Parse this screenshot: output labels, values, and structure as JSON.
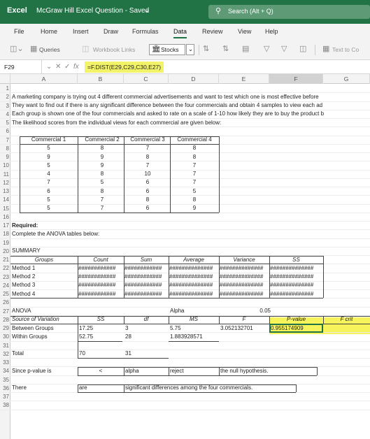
{
  "app": {
    "name": "Excel",
    "doc_title": "McGraw Hill Excel Question  -  Saved",
    "search_placeholder": "Search (Alt + Q)"
  },
  "menu": [
    "File",
    "Home",
    "Insert",
    "Draw",
    "Formulas",
    "Data",
    "Review",
    "View",
    "Help"
  ],
  "ribbon": {
    "queries": "Queries",
    "workbook_links": "Workbook Links",
    "stocks": "Stocks",
    "text_to_cols": "Text to Co"
  },
  "formula_bar": {
    "name_box": "F29",
    "fx": "fx",
    "formula": "=F.DIST(E29,C29,C30,E27)"
  },
  "columns": [
    "A",
    "B",
    "C",
    "D",
    "E",
    "F",
    "G"
  ],
  "rows": [
    "1",
    "2",
    "3",
    "4",
    "5",
    "6",
    "7",
    "8",
    "9",
    "10",
    "11",
    "12",
    "13",
    "14",
    "15",
    "16",
    "17",
    "18",
    "19",
    "20",
    "21",
    "22",
    "23",
    "24",
    "25",
    "26",
    "27",
    "28",
    "29",
    "30",
    "31",
    "32",
    "33",
    "34",
    "35",
    "36",
    "37",
    "38"
  ],
  "intro": {
    "l2": "A marketing company is trying out 4 different commercial advertisements and want to test which one is most effective before",
    "l3": "They want to find out if there is any significant difference between the four commercials and obtain 4 samples to view each ad",
    "l4": "Each group is shown one of the four commercials and asked to rate on a scale of 1-10 how likely they are to buy the product b",
    "l5": "The likelihood scores from the individual views for each commercial are given below:"
  },
  "data_table": {
    "headers": [
      "Commercial 1",
      "Commercial 2",
      "Commercial 3",
      "Commercial 4"
    ],
    "rows": [
      [
        "5",
        "8",
        "7",
        "8"
      ],
      [
        "9",
        "9",
        "8",
        "8"
      ],
      [
        "5",
        "9",
        "7",
        "7"
      ],
      [
        "4",
        "8",
        "10",
        "7"
      ],
      [
        "7",
        "5",
        "6",
        "7"
      ],
      [
        "6",
        "8",
        "6",
        "5"
      ],
      [
        "5",
        "7",
        "8",
        "8"
      ],
      [
        "5",
        "7",
        "6",
        "9"
      ]
    ]
  },
  "required": {
    "label": "Required:",
    "text": "Complete the ANOVA tables below:"
  },
  "summary": {
    "title": "SUMMARY",
    "headers": [
      "Groups",
      "Count",
      "Sum",
      "Average",
      "Variance",
      "SS"
    ],
    "rows": [
      [
        "Method 1",
        "############",
        "############",
        "##############",
        "##############",
        "##############"
      ],
      [
        "Method 2",
        "############",
        "############",
        "##############",
        "##############",
        "##############"
      ],
      [
        "Method 3",
        "############",
        "############",
        "##############",
        "##############",
        "##############"
      ],
      [
        "Method 4",
        "############",
        "############",
        "##############",
        "##############",
        "##############"
      ]
    ]
  },
  "anova": {
    "title": "ANOVA",
    "alpha_label": "Alpha",
    "alpha_value": "0.05",
    "headers": [
      "Source of Variation",
      "SS",
      "df",
      "MS",
      "F",
      "P-value",
      "F crit"
    ],
    "between": [
      "Between Groups",
      "17.25",
      "3",
      "5.75",
      "3.052132701",
      "0.955174909"
    ],
    "within": [
      "Within Groups",
      "52.75",
      "28",
      "1.883928571"
    ],
    "total": [
      "Total",
      "70",
      "31"
    ]
  },
  "conclusion": {
    "r34": [
      "Since p-value is",
      "<",
      "alpha",
      "reject",
      "the null hypothesis."
    ],
    "r36": [
      "There",
      "are",
      "significant differences among the four commercials."
    ]
  }
}
